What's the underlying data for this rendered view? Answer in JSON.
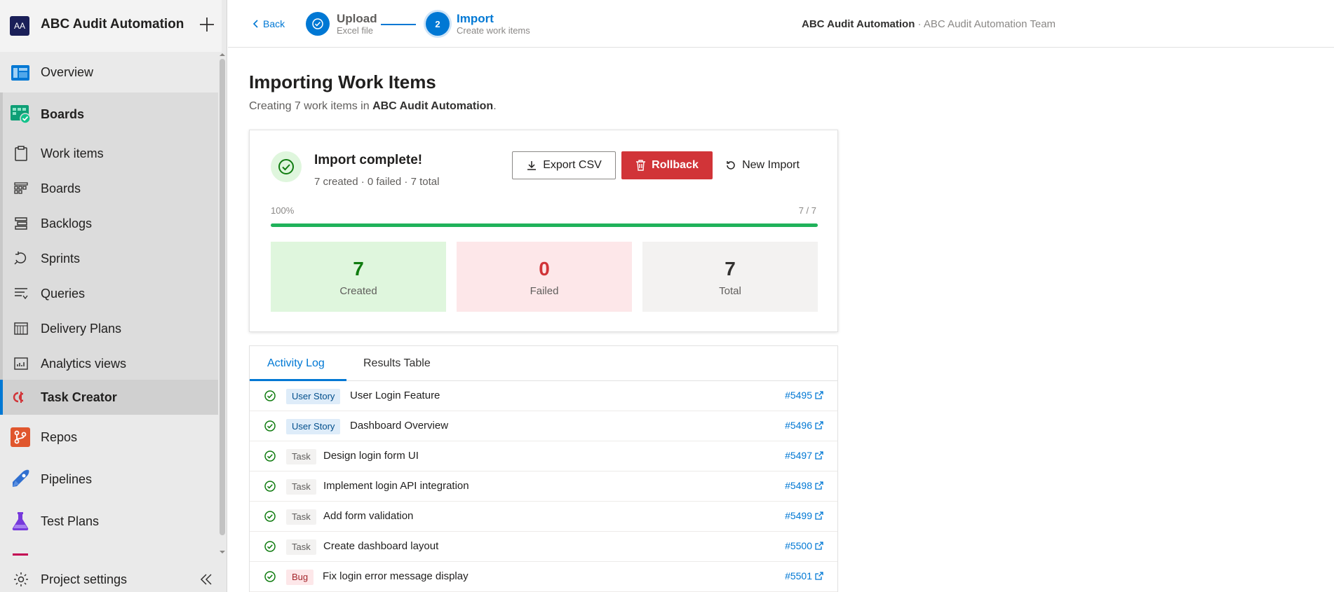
{
  "org": {
    "avatar": "AA",
    "name": "ABC Audit Automation"
  },
  "nav": {
    "overview": "Overview",
    "boards_section": "Boards",
    "work_items": "Work items",
    "boards": "Boards",
    "backlogs": "Backlogs",
    "sprints": "Sprints",
    "queries": "Queries",
    "delivery_plans": "Delivery Plans",
    "analytics_views": "Analytics views",
    "task_creator": "Task Creator",
    "repos": "Repos",
    "pipelines": "Pipelines",
    "test_plans": "Test Plans",
    "project_settings": "Project settings"
  },
  "topbar": {
    "back": "Back",
    "steps": [
      {
        "number": "",
        "title": "Upload",
        "subtitle": "Excel file"
      },
      {
        "number": "2",
        "title": "Import",
        "subtitle": "Create work items"
      }
    ],
    "project": "ABC Audit Automation",
    "team": " · ABC Audit Automation Team"
  },
  "page": {
    "title": "Importing Work Items",
    "subtitle_prefix": "Creating 7 work items in ",
    "subtitle_project": "ABC Audit Automation",
    "subtitle_suffix": "."
  },
  "status": {
    "title": "Import complete!",
    "summary": "7 created · 0 failed · 7 total",
    "export_label": "Export CSV",
    "rollback_label": "Rollback",
    "new_import_label": "New Import",
    "progress_percent_label": "100%",
    "progress_count_label": "7 / 7",
    "progress_fraction": 1.0
  },
  "stats": {
    "created": {
      "value": "7",
      "label": "Created"
    },
    "failed": {
      "value": "0",
      "label": "Failed"
    },
    "total": {
      "value": "7",
      "label": "Total"
    }
  },
  "tabs": {
    "activity": "Activity Log",
    "results": "Results Table"
  },
  "log": [
    {
      "type": "User Story",
      "kind": "story",
      "title": "User Login Feature",
      "id": "#5495"
    },
    {
      "type": "User Story",
      "kind": "story",
      "title": "Dashboard Overview",
      "id": "#5496"
    },
    {
      "type": "Task",
      "kind": "task",
      "title": "Design login form UI",
      "id": "#5497"
    },
    {
      "type": "Task",
      "kind": "task",
      "title": "Implement login API integration",
      "id": "#5498"
    },
    {
      "type": "Task",
      "kind": "task",
      "title": "Add form validation",
      "id": "#5499"
    },
    {
      "type": "Task",
      "kind": "task",
      "title": "Create dashboard layout",
      "id": "#5500"
    },
    {
      "type": "Bug",
      "kind": "bug",
      "title": "Fix login error message display",
      "id": "#5501"
    }
  ],
  "colors": {
    "accent": "#0078d4",
    "success": "#107c10",
    "danger": "#d13438",
    "progress": "#20b25a"
  }
}
